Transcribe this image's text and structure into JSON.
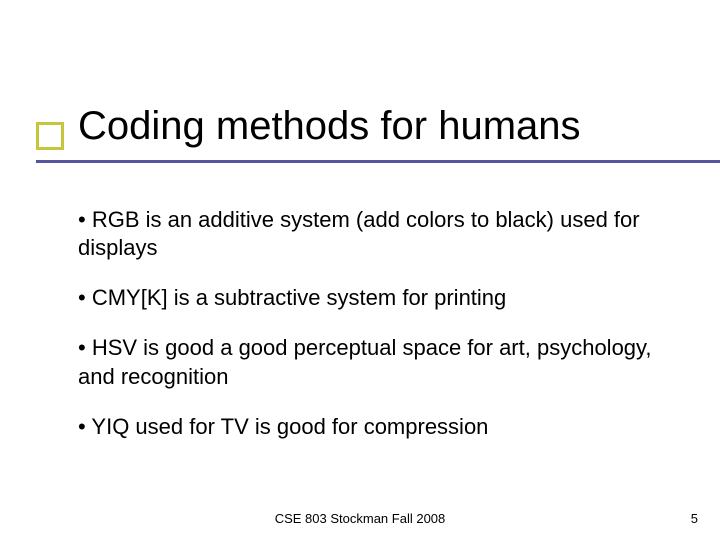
{
  "title": "Coding methods for humans",
  "bullets": [
    "• RGB is an additive system (add colors to black) used for displays",
    "• CMY[K] is a subtractive system for printing",
    "• HSV is good a good perceptual space for art, psychology, and recognition",
    "• YIQ used for TV is good for compression"
  ],
  "footer": {
    "center": "CSE 803 Stockman Fall 2008",
    "page": "5"
  }
}
